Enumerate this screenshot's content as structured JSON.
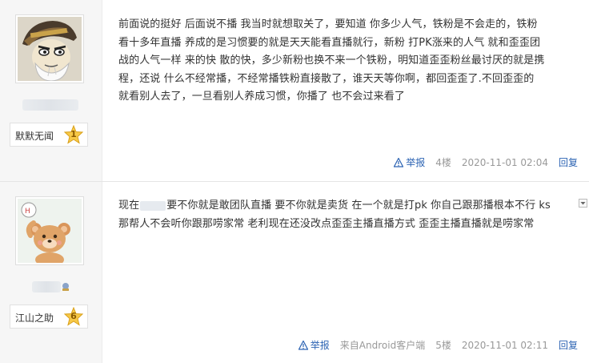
{
  "posts": [
    {
      "user": {
        "name": "默默无闻",
        "level": "1"
      },
      "content": {
        "lines": [
          "前面说的挺好 后面说不播 我当时就想取关了，要知道 你多少人气，铁粉是不会走的，铁粉",
          "看十多年直播 养成的是习惯要的就是天天能看直播就行，新粉 打PK涨来的人气 就和歪歪团",
          "战的人气一样 来的快 散的快，多少新粉也换不来一个铁粉，明知道歪歪粉丝最讨厌的就是携",
          "程，还说 什么不经常播，不经常播铁粉直接散了，谁天天等你啊，都回歪歪了.不回歪歪的",
          "就看别人去了，一旦看别人养成习惯，你播了 也不会过来看了"
        ]
      },
      "footer": {
        "report": "举报",
        "floor": "4楼",
        "time": "2020-11-01 02:04",
        "reply": "回复"
      }
    },
    {
      "user": {
        "name": "江山之助",
        "level": "6"
      },
      "content": {
        "line1_a": "现在",
        "line1_b": "要不你就是敢团队直播 要不你就是卖货 在一个就是打pk 你自己跟那播根本不行 ks",
        "line2": "那帮人不会听你跟那唠家常 老利现在还没改点歪歪主播直播方式 歪歪主播直播就是唠家常"
      },
      "footer": {
        "report": "举报",
        "source": "来自Android客户端",
        "floor": "5楼",
        "time": "2020-11-01 02:11",
        "reply": "回复"
      }
    }
  ],
  "colors": {
    "link": "#2d64b3",
    "meta": "#999999",
    "text": "#333333",
    "sidebar_bg": "#f6f6f6"
  }
}
